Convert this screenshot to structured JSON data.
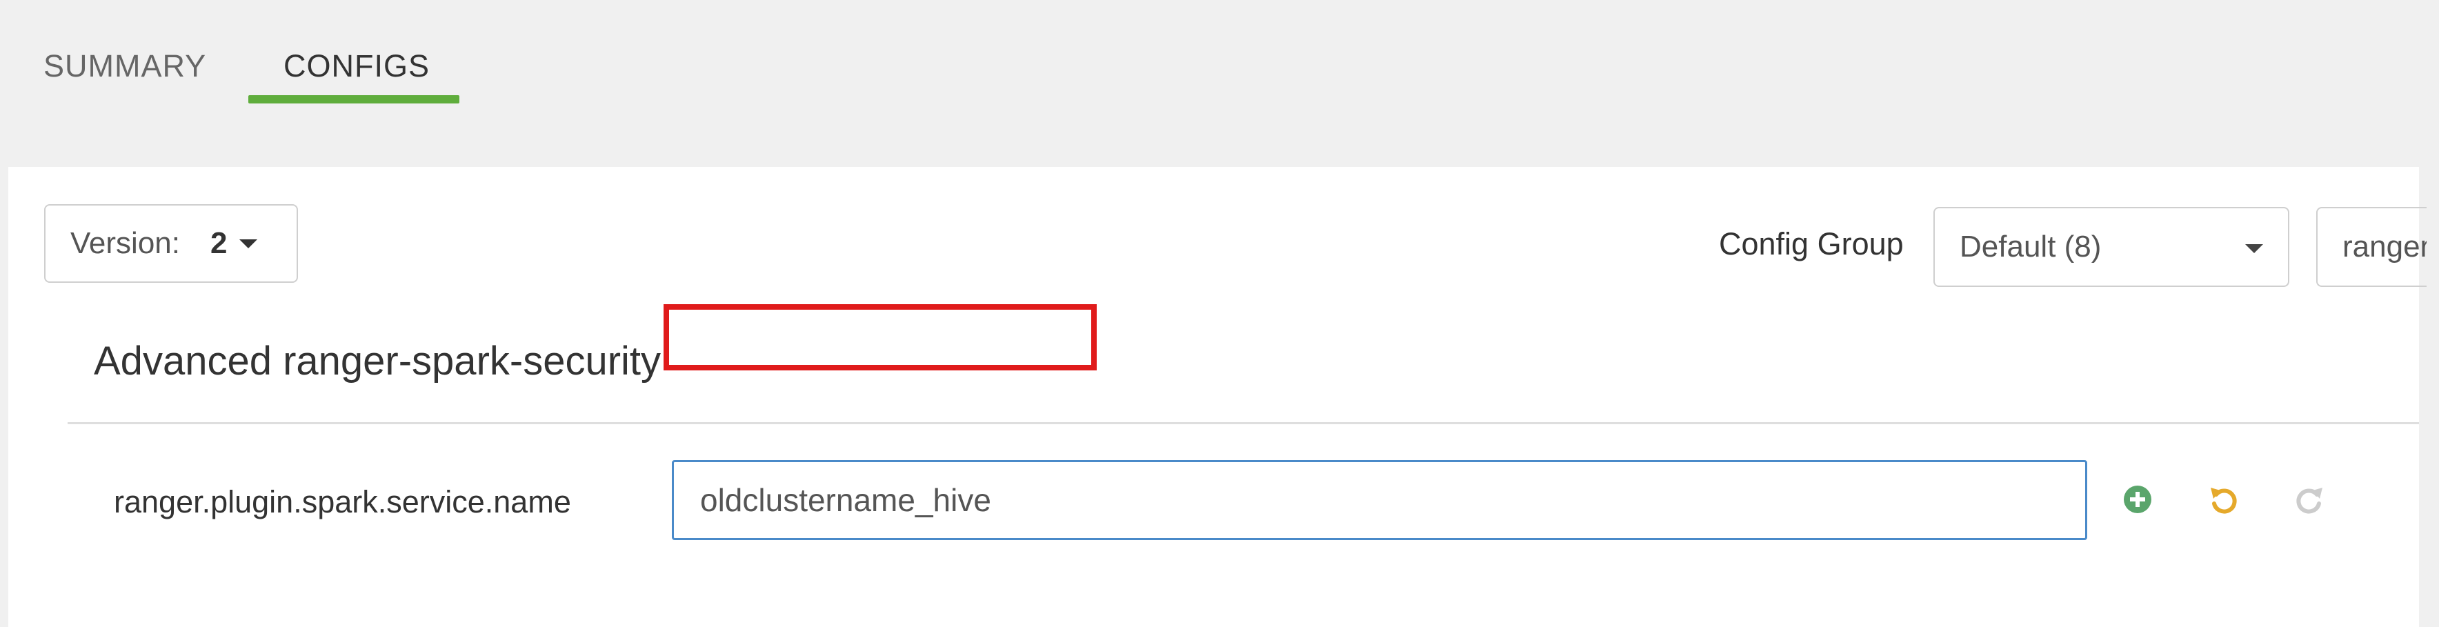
{
  "tabs": [
    {
      "label": "SUMMARY",
      "active": false
    },
    {
      "label": "CONFIGS",
      "active": true
    }
  ],
  "toolbar": {
    "version_label": "Version:",
    "version_value": "2",
    "config_group_label": "Config Group",
    "config_group_value": "Default (8)",
    "filter_value": "ranger"
  },
  "section": {
    "title": "Advanced ranger-spark-security"
  },
  "property": {
    "name": "ranger.plugin.spark.service.name",
    "value": "oldclustername_hive"
  },
  "icons": {
    "add": "plus-circle-icon",
    "undo": "undo-icon",
    "redo": "redo-icon"
  },
  "colors": {
    "active_tab_underline": "#5fad3c",
    "input_focus_border": "#4a8ac9",
    "highlight_box": "#e01b1b",
    "add_icon": "#5aa56b",
    "undo_icon": "#e5a92b",
    "redo_icon_disabled": "#cccccc"
  }
}
